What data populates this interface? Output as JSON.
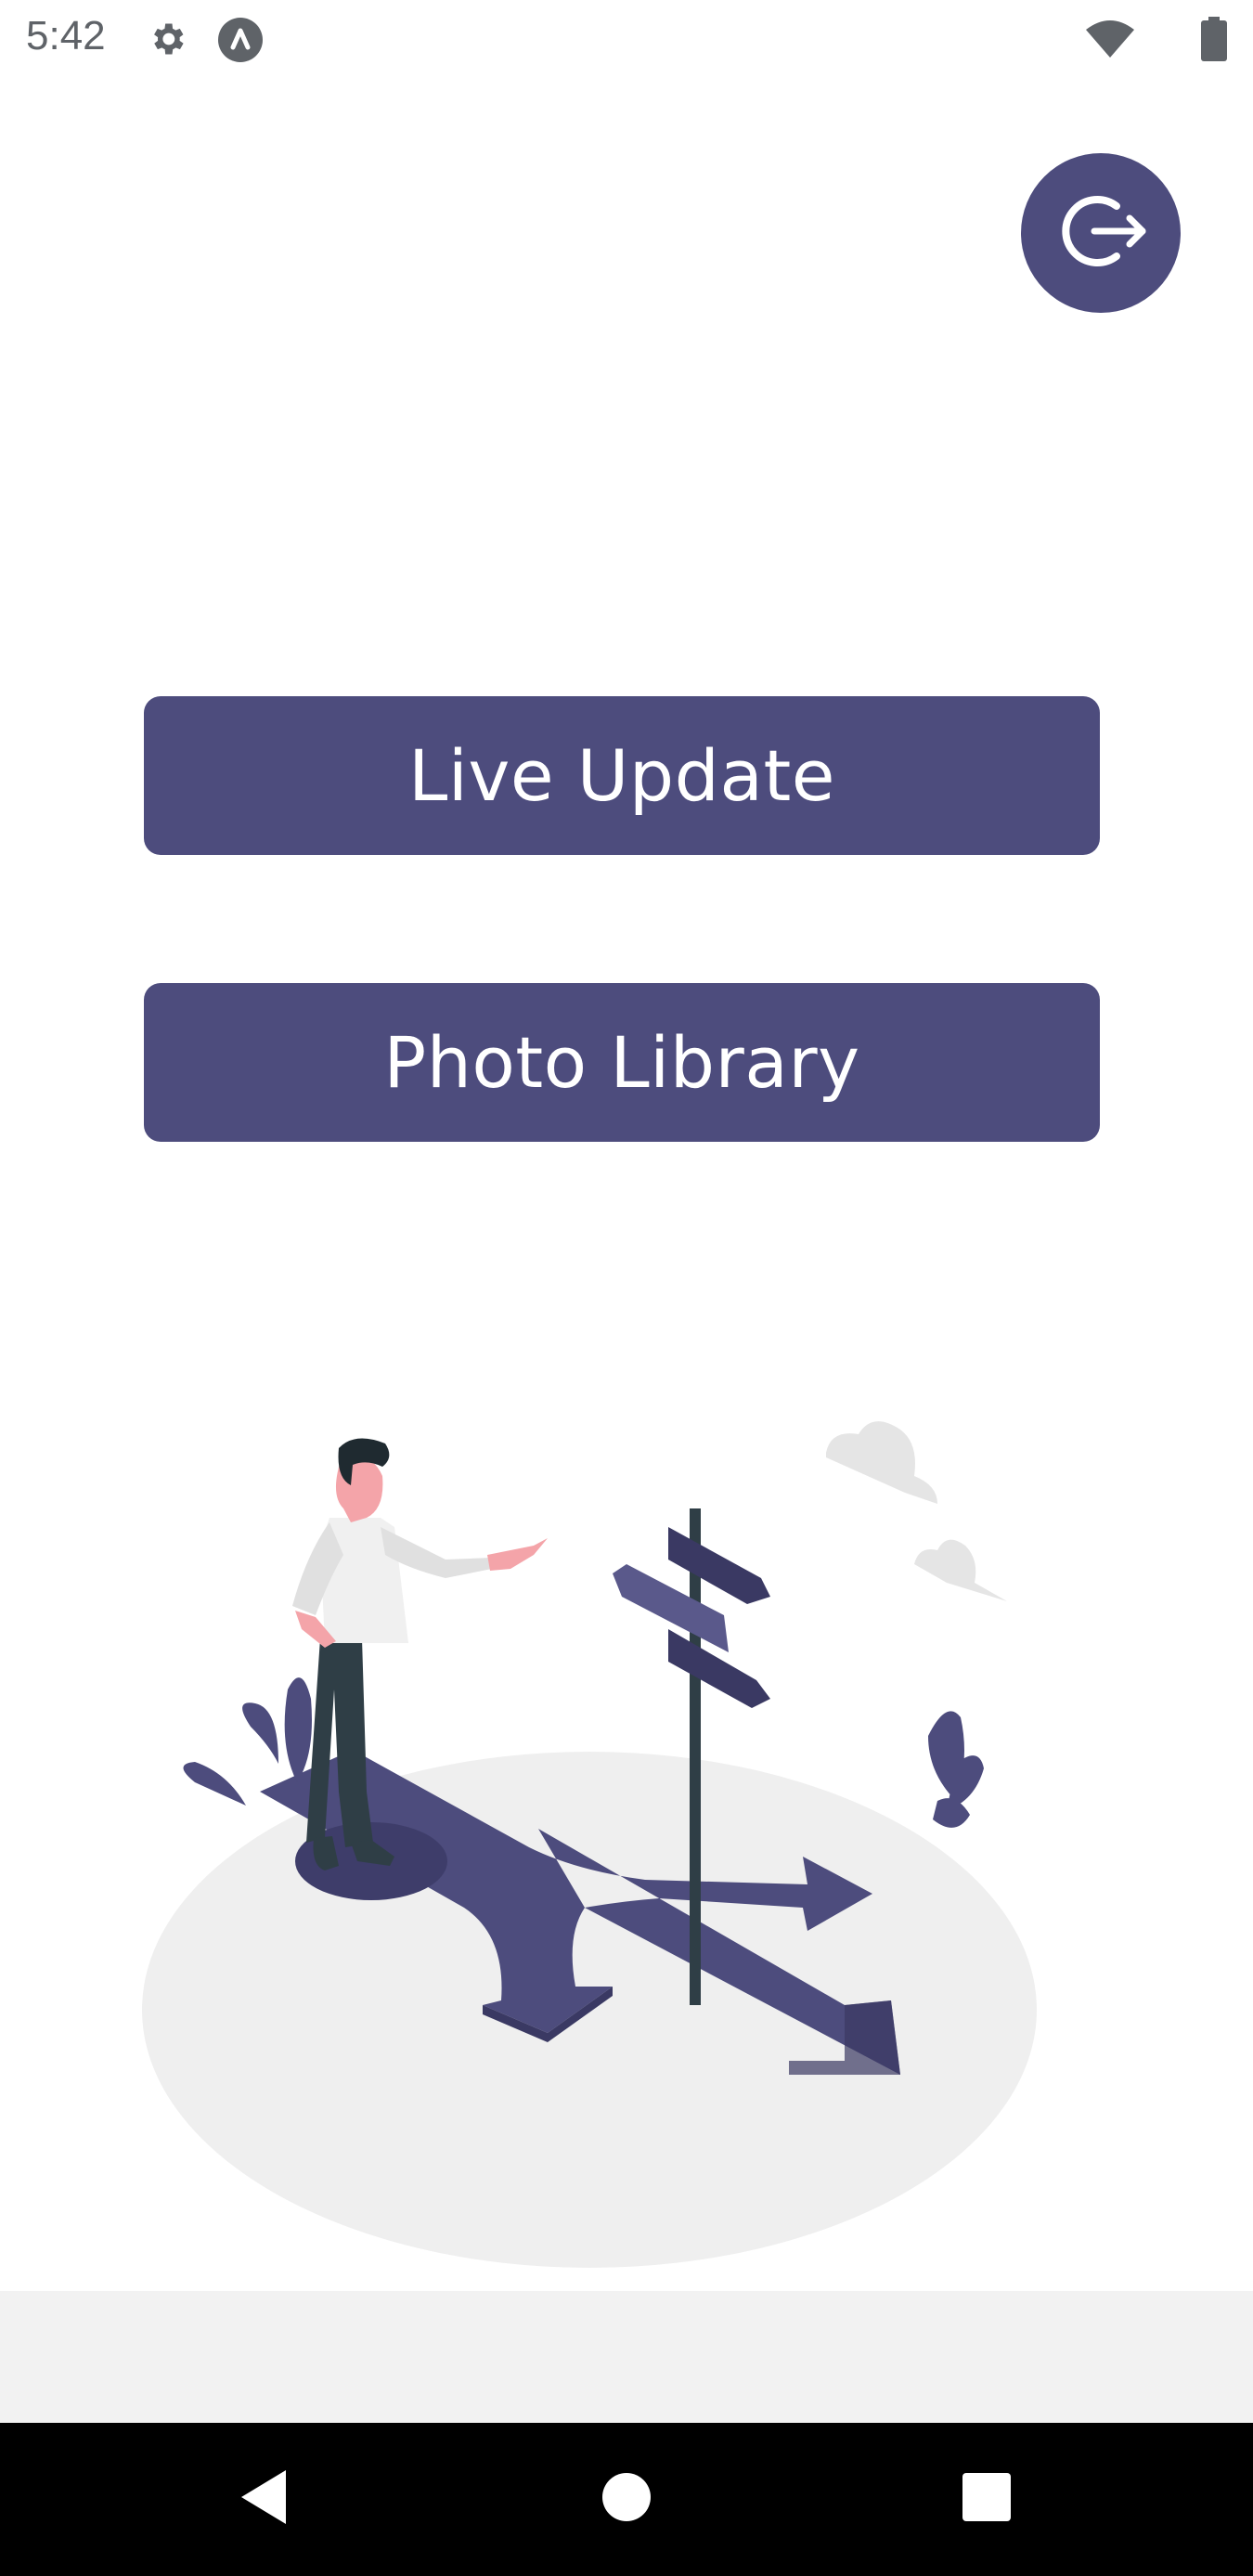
{
  "status_bar": {
    "time": "5:42",
    "icons": [
      "gear-icon",
      "app-notification-icon",
      "wifi-icon",
      "battery-icon"
    ]
  },
  "header": {
    "logout_icon": "logout-icon"
  },
  "main": {
    "buttons": [
      {
        "label": "Live Update"
      },
      {
        "label": "Photo Library"
      }
    ]
  },
  "illustration": {
    "description_icon": "crossroads-illustration"
  },
  "nav_bar": {
    "icons": [
      "back-icon",
      "home-icon",
      "recents-icon"
    ]
  },
  "colors": {
    "accent": "#4d4c7d",
    "background": "#ffffff",
    "nav_background": "#000000"
  }
}
